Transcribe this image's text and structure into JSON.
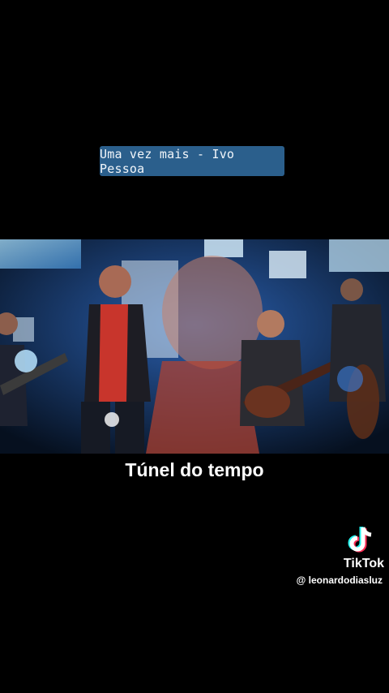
{
  "overlay": {
    "song_title": "Uma vez mais - Ivo Pessoa",
    "subtitle": "Túnel do tempo"
  },
  "tiktok": {
    "brand": "TikTok",
    "username": "@ leonardodiasluz",
    "logo_icon": "tiktok-note-icon"
  },
  "colors": {
    "background": "#000000",
    "caption_box": "#2b5f8c",
    "stage_blue": "#1a4fa0",
    "shirt_red": "#c8352c"
  }
}
